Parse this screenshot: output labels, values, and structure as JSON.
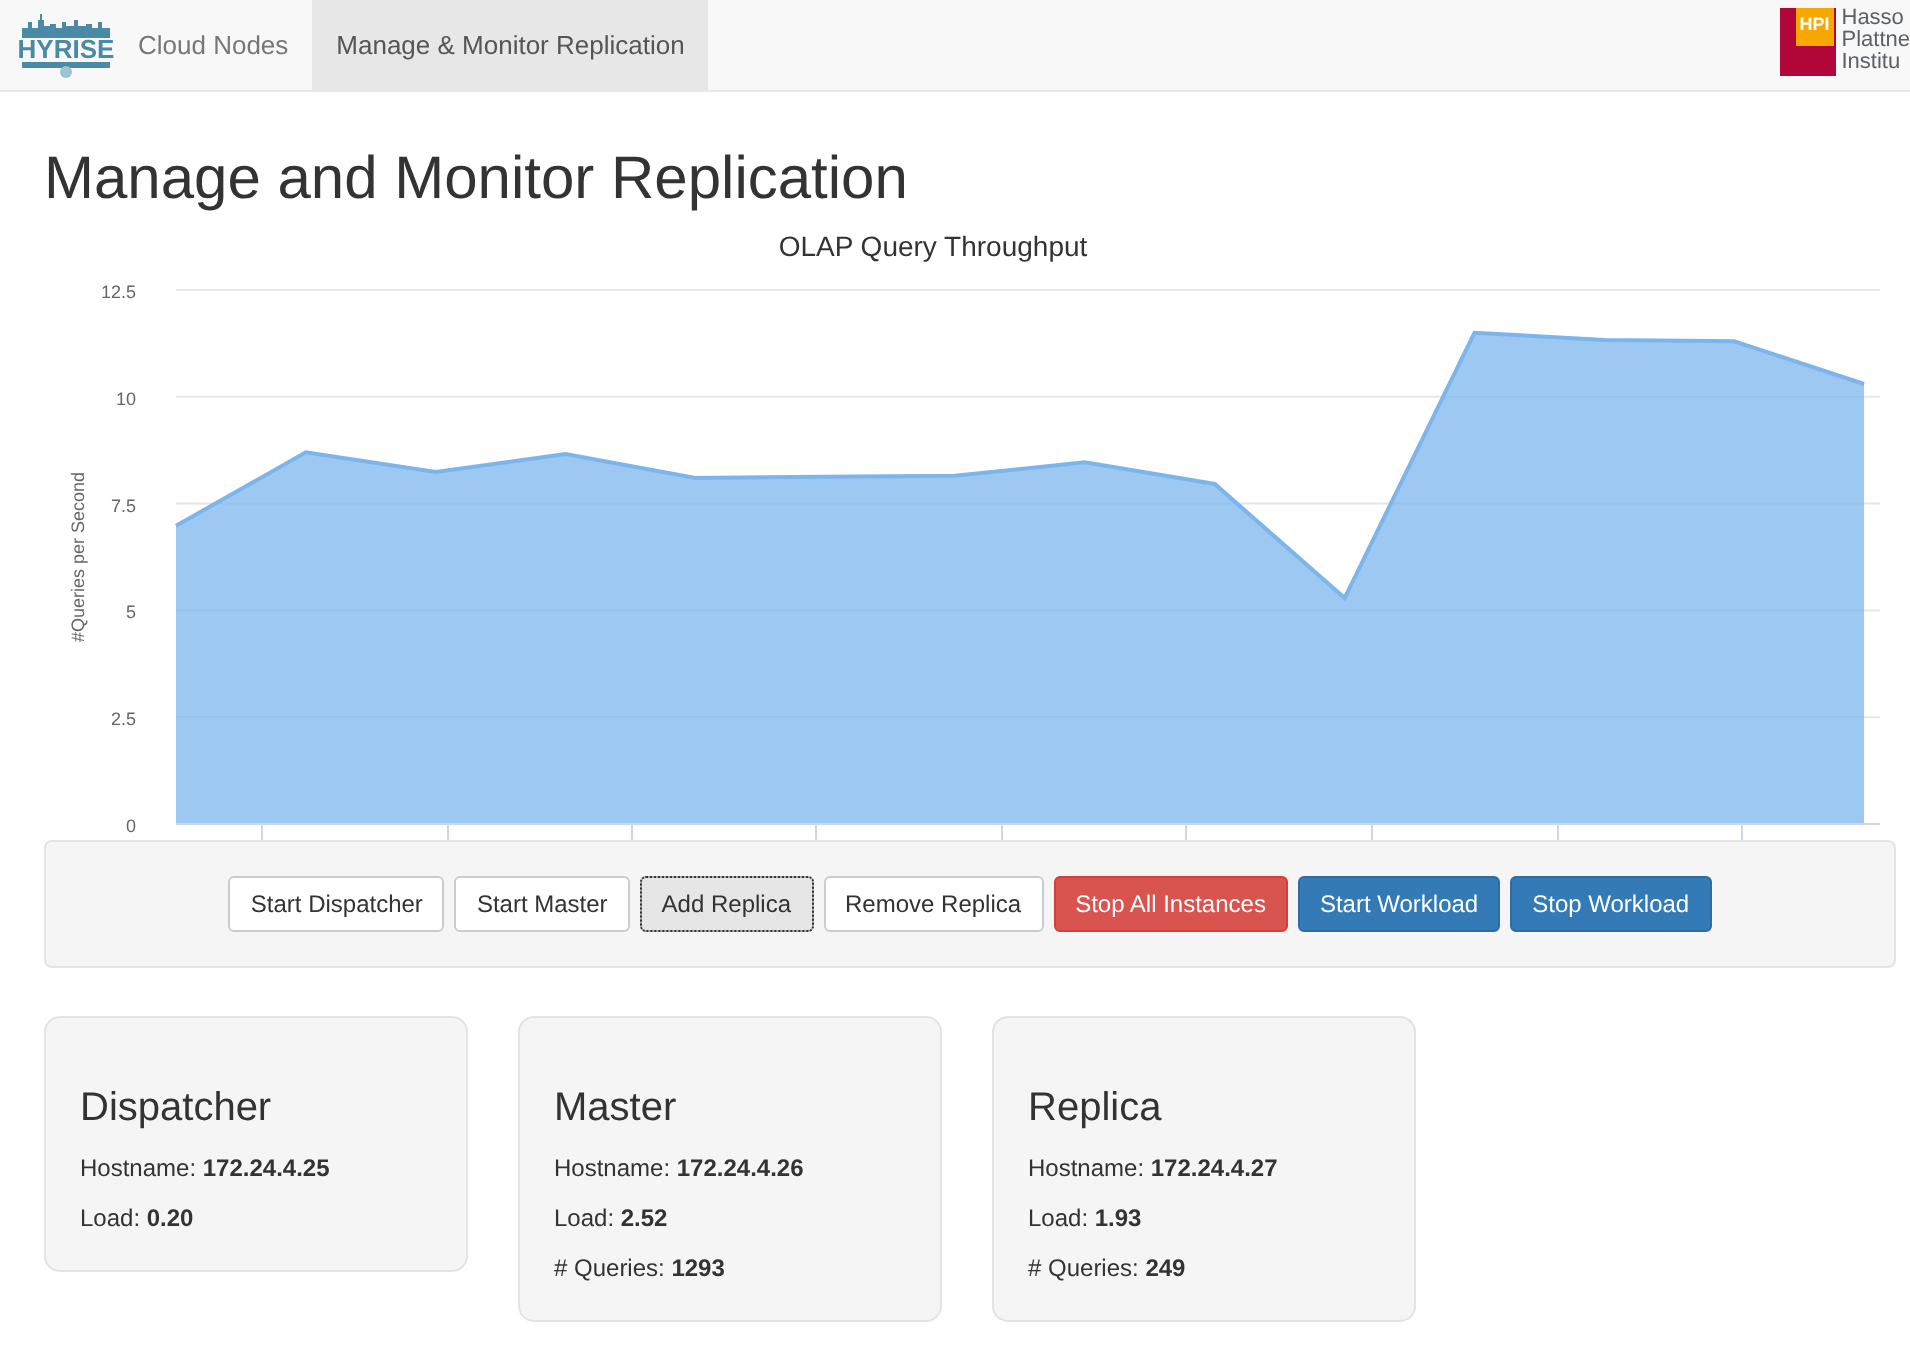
{
  "navbar": {
    "brand": "HYRISE",
    "items": [
      {
        "label": "Cloud Nodes",
        "selected": false
      },
      {
        "label": "Manage & Monitor Replication",
        "selected": true
      }
    ],
    "partner_logo": {
      "badge": "HPI",
      "lines": [
        "Hasso",
        "Plattne",
        "Institu"
      ]
    }
  },
  "page_title": "Manage and Monitor Replication",
  "chart": {
    "chart_data": {
      "type": "area",
      "grid": true,
      "title": "OLAP Query Throughput",
      "ylabel": "#Queries per Second",
      "ylim": [
        0,
        12.5
      ],
      "yticks": [
        0,
        2.5,
        5,
        7.5,
        10,
        12.5
      ],
      "series": [
        {
          "color": "#7cb5ec",
          "values": [
            6.98,
            8.7,
            8.24,
            8.66,
            8.1,
            8.13,
            8.15,
            8.47,
            7.96,
            5.29,
            11.5,
            11.33,
            11.3,
            10.3
          ]
        }
      ]
    }
  },
  "actions": [
    {
      "label": "Start Dispatcher",
      "kind": "default",
      "focused": false
    },
    {
      "label": "Start Master",
      "kind": "default",
      "focused": false
    },
    {
      "label": "Add Replica",
      "kind": "default",
      "focused": true
    },
    {
      "label": "Remove Replica",
      "kind": "default",
      "focused": false
    },
    {
      "label": "Stop All Instances",
      "kind": "danger",
      "focused": false
    },
    {
      "label": "Start Workload",
      "kind": "primary",
      "focused": false
    },
    {
      "label": "Stop Workload",
      "kind": "primary",
      "focused": false
    }
  ],
  "nodes": [
    {
      "title": "Dispatcher",
      "fields": [
        {
          "label": "Hostname:",
          "value": "172.24.4.25"
        },
        {
          "label": "Load:",
          "value": "0.20"
        }
      ]
    },
    {
      "title": "Master",
      "fields": [
        {
          "label": "Hostname:",
          "value": "172.24.4.26"
        },
        {
          "label": "Load:",
          "value": "2.52"
        },
        {
          "label": "# Queries:",
          "value": "1293"
        }
      ]
    },
    {
      "title": "Replica",
      "fields": [
        {
          "label": "Hostname:",
          "value": "172.24.4.27"
        },
        {
          "label": "Load:",
          "value": "1.93"
        },
        {
          "label": "# Queries:",
          "value": "249"
        }
      ]
    }
  ]
}
